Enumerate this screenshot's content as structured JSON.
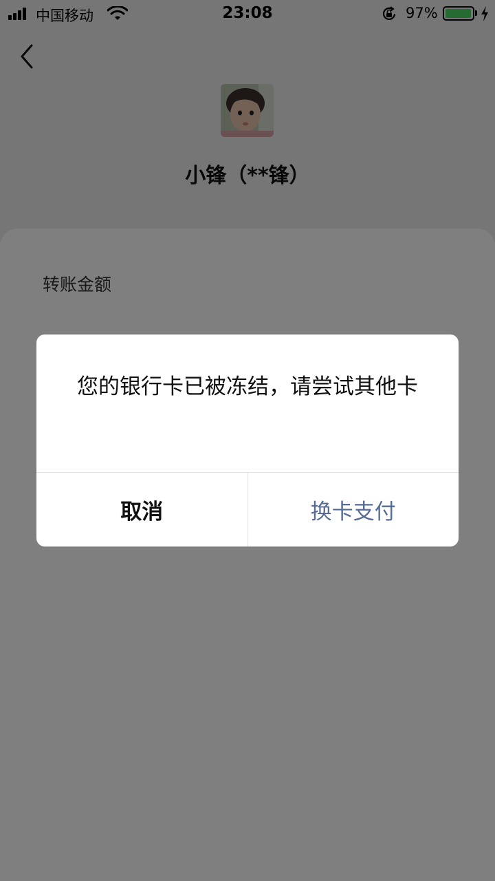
{
  "status_bar": {
    "carrier": "中国移动",
    "time": "23:08",
    "battery_percent": "97%",
    "battery_level": 0.97,
    "icons": [
      "signal-icon",
      "wifi-icon",
      "rotation-lock-icon",
      "battery-icon",
      "charging-icon"
    ]
  },
  "header": {
    "back_icon": "chevron-left-icon",
    "payee_name": "小锋（**锋）"
  },
  "transfer": {
    "amount_label": "转账金额"
  },
  "dialog": {
    "message": "您的银行卡已被冻结，请尝试其他卡",
    "cancel_label": "取消",
    "confirm_label": "换卡支付"
  },
  "colors": {
    "accent": "#576b95",
    "battery": "#4cd964",
    "page_background": "#ededed"
  }
}
